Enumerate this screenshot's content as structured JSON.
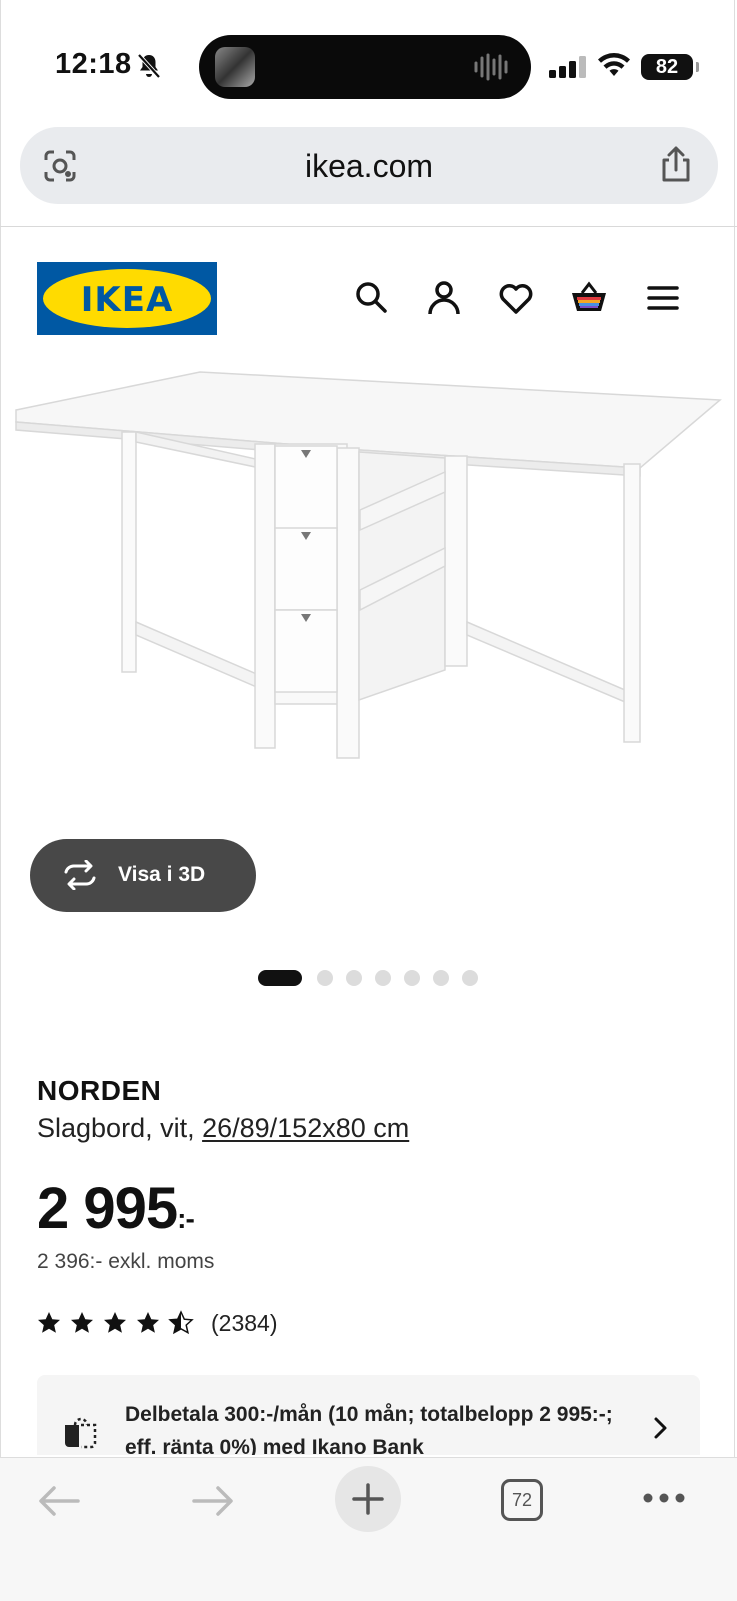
{
  "status_bar": {
    "time": "12:18",
    "battery": "82"
  },
  "browser": {
    "url": "ikea.com",
    "tab_count": "72"
  },
  "header": {
    "logo_text": "IKEA",
    "icons": [
      "search-icon",
      "profile-icon",
      "heart-icon",
      "basket-icon",
      "menu-icon"
    ]
  },
  "gallery": {
    "view_3d_label": "Visa i 3D",
    "image_count": 7,
    "active_index": 0
  },
  "product": {
    "name": "NORDEN",
    "description": "Slagbord, vit, ",
    "dimensions": "26/89/152x80 cm",
    "price": "2 995",
    "price_suffix": ":-",
    "price_ex_vat": "2 396:- exkl. moms",
    "rating": 4.5,
    "rating_count": "(2384)"
  },
  "financing": {
    "text": "Delbetala 300:-/mån (10 mån; totalbelopp 2 995:-; eff. ränta 0%) med Ikano Bank"
  },
  "colors": {
    "ikea_blue": "#0058a3",
    "ikea_yellow": "#ffdb00",
    "button_dark": "#484848"
  }
}
